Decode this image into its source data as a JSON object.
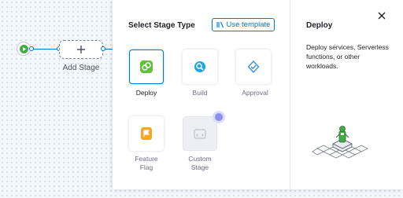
{
  "pipeline": {
    "add_stage_label": "Add Stage"
  },
  "dialog": {
    "title": "Select Stage Type",
    "template_button": "Use template",
    "stage_types": [
      {
        "label": "Deploy",
        "icon": "deploy-icon",
        "selected": true
      },
      {
        "label": "Build",
        "icon": "build-icon",
        "selected": false
      },
      {
        "label": "Approval",
        "icon": "approval-icon",
        "selected": false
      },
      {
        "label": "Feature Flag",
        "icon": "feature-flag-icon",
        "selected": false
      },
      {
        "label": "Custom Stage",
        "icon": "custom-stage-icon",
        "selected": false
      }
    ]
  },
  "description": {
    "title": "Deploy",
    "text": "Deploy services, Serverless functions, or other workloads."
  },
  "colors": {
    "accent": "#0278d5",
    "play": "#42ab45",
    "custom_badge": "#8c8ef0"
  }
}
